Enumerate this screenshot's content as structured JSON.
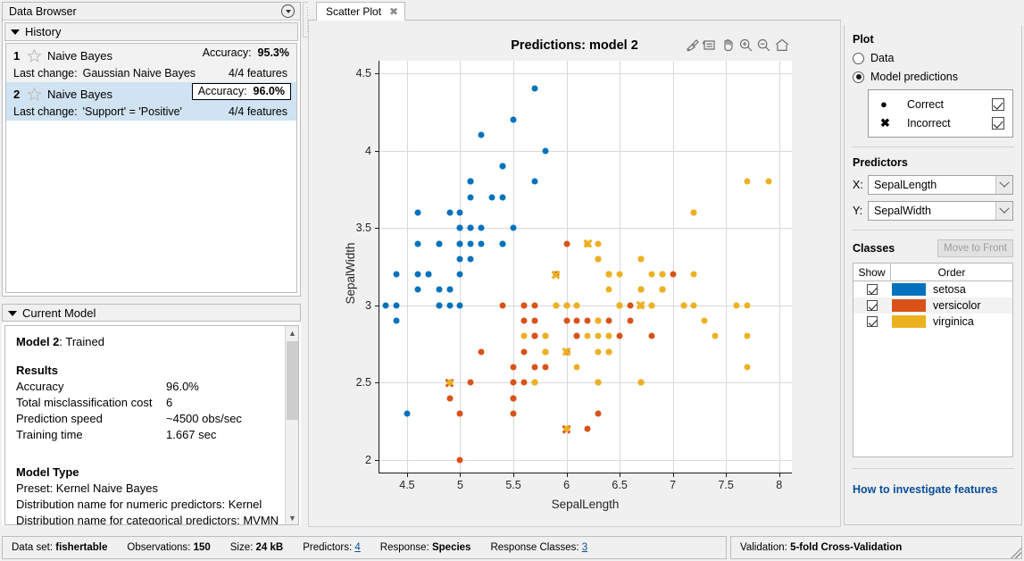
{
  "data_browser": {
    "title": "Data Browser",
    "collapse_icon": "chevron-down-circle-icon",
    "history": {
      "title": "History",
      "items": [
        {
          "index": "1",
          "name": "Naive Bayes",
          "accuracy_label": "Accuracy:",
          "accuracy_value": "95.3%",
          "last_change_label": "Last change:",
          "last_change_value": "Gaussian Naive Bayes",
          "features": "4/4 features",
          "selected": false
        },
        {
          "index": "2",
          "name": "Naive Bayes",
          "accuracy_label": "Accuracy:",
          "accuracy_value": "96.0%",
          "last_change_label": "Last change:",
          "last_change_value": "'Support' = 'Positive'",
          "features": "4/4 features",
          "selected": true
        }
      ]
    }
  },
  "current_model": {
    "title": "Current Model",
    "heading_bold": "Model 2",
    "heading_rest": ": Trained",
    "results_title": "Results",
    "results": [
      {
        "key": "Accuracy",
        "value": "96.0%"
      },
      {
        "key": "Total misclassification cost",
        "value": "6"
      },
      {
        "key": "Prediction speed",
        "value": "~4500 obs/sec"
      },
      {
        "key": "Training time",
        "value": "1.667 sec"
      }
    ],
    "model_type_title": "Model Type",
    "model_type_lines": [
      "Preset: Kernel Naive Bayes",
      "Distribution name for numeric predictors: Kernel",
      "Distribution name for categorical predictors: MVMN"
    ]
  },
  "tabs": [
    {
      "label": "Scatter Plot",
      "close_icon": "close-icon",
      "active": true
    }
  ],
  "plot_toolbar": [
    "brush-data-icon",
    "export-legend-icon",
    "pan-hand-icon",
    "zoom-in-icon",
    "zoom-out-icon",
    "restore-home-icon"
  ],
  "right_panel": {
    "plot_section_title": "Plot",
    "radios": [
      {
        "label": "Data",
        "selected": false
      },
      {
        "label": "Model predictions",
        "selected": true
      }
    ],
    "legend": [
      {
        "glyph": "filled-circle-marker",
        "label": "Correct",
        "checked": true
      },
      {
        "glyph": "cross-marker",
        "label": "Incorrect",
        "checked": true
      }
    ],
    "predictors_title": "Predictors",
    "predictor_x_label": "X:",
    "predictor_x_value": "SepalLength",
    "predictor_y_label": "Y:",
    "predictor_y_value": "SepalWidth",
    "classes_title": "Classes",
    "move_to_front_label": "Move to Front",
    "class_table": {
      "columns": [
        "Show",
        "Order"
      ],
      "rows": [
        {
          "show": true,
          "color": "#0072BD",
          "name": "setosa"
        },
        {
          "show": true,
          "color": "#D95319",
          "name": "versicolor"
        },
        {
          "show": true,
          "color": "#EDB120",
          "name": "virginica"
        }
      ]
    },
    "how_to_link": "How to investigate features"
  },
  "status_bar": {
    "left": [
      {
        "label": "Data set:",
        "value": "fishertable",
        "bold": true,
        "link": false
      },
      {
        "label": "Observations:",
        "value": "150",
        "bold": true,
        "link": false
      },
      {
        "label": "Size:",
        "value": "24 kB",
        "bold": true,
        "link": false
      },
      {
        "label": "Predictors:",
        "value": "4",
        "bold": false,
        "link": true
      },
      {
        "label": "Response:",
        "value": "Species",
        "bold": true,
        "link": false
      },
      {
        "label": "Response Classes:",
        "value": "3",
        "bold": false,
        "link": true
      }
    ],
    "right": [
      {
        "label": "Validation:",
        "value": "5-fold Cross-Validation",
        "bold": true,
        "link": false
      }
    ]
  },
  "chart_data": {
    "type": "scatter",
    "title": "Predictions: model 2",
    "xlabel": "SepalLength",
    "ylabel": "SepalWidth",
    "xlim": [
      4.24,
      8.12
    ],
    "ylim": [
      1.92,
      4.58
    ],
    "xticks": [
      4.5,
      5,
      5.5,
      6,
      6.5,
      7,
      7.5,
      8
    ],
    "yticks": [
      2,
      2.5,
      3,
      3.5,
      4,
      4.5
    ],
    "grid": true,
    "legend_position": "external-right-panel",
    "series": [
      {
        "name": "setosa",
        "color": "#0072BD",
        "correct": [
          [
            5.1,
            3.5
          ],
          [
            4.9,
            3.0
          ],
          [
            4.7,
            3.2
          ],
          [
            4.6,
            3.1
          ],
          [
            5.0,
            3.6
          ],
          [
            5.4,
            3.9
          ],
          [
            4.6,
            3.4
          ],
          [
            5.0,
            3.4
          ],
          [
            4.4,
            2.9
          ],
          [
            4.9,
            3.1
          ],
          [
            5.4,
            3.7
          ],
          [
            4.8,
            3.4
          ],
          [
            4.8,
            3.0
          ],
          [
            4.3,
            3.0
          ],
          [
            5.8,
            4.0
          ],
          [
            5.7,
            4.4
          ],
          [
            5.4,
            3.9
          ],
          [
            5.1,
            3.5
          ],
          [
            5.7,
            3.8
          ],
          [
            5.1,
            3.8
          ],
          [
            5.4,
            3.4
          ],
          [
            5.1,
            3.7
          ],
          [
            4.6,
            3.6
          ],
          [
            5.1,
            3.3
          ],
          [
            4.8,
            3.4
          ],
          [
            5.0,
            3.0
          ],
          [
            5.0,
            3.4
          ],
          [
            5.2,
            3.5
          ],
          [
            5.2,
            3.4
          ],
          [
            4.7,
            3.2
          ],
          [
            4.8,
            3.1
          ],
          [
            5.4,
            3.4
          ],
          [
            5.2,
            4.1
          ],
          [
            5.5,
            4.2
          ],
          [
            4.9,
            3.1
          ],
          [
            5.0,
            3.2
          ],
          [
            5.5,
            3.5
          ],
          [
            4.9,
            3.6
          ],
          [
            4.4,
            3.0
          ],
          [
            5.1,
            3.4
          ],
          [
            5.0,
            3.5
          ],
          [
            4.5,
            2.3
          ],
          [
            4.4,
            3.2
          ],
          [
            5.0,
            3.5
          ],
          [
            5.1,
            3.8
          ],
          [
            4.8,
            3.0
          ],
          [
            5.1,
            3.8
          ],
          [
            4.6,
            3.2
          ],
          [
            5.3,
            3.7
          ],
          [
            5.0,
            3.3
          ]
        ],
        "incorrect": []
      },
      {
        "name": "versicolor",
        "color": "#D95319",
        "correct": [
          [
            7.0,
            3.2
          ],
          [
            6.4,
            3.2
          ],
          [
            6.9,
            3.1
          ],
          [
            5.5,
            2.3
          ],
          [
            6.5,
            2.8
          ],
          [
            5.7,
            2.8
          ],
          [
            4.9,
            2.4
          ],
          [
            6.6,
            2.9
          ],
          [
            5.2,
            2.7
          ],
          [
            5.0,
            2.0
          ],
          [
            5.9,
            3.0
          ],
          [
            6.0,
            2.2
          ],
          [
            6.1,
            2.9
          ],
          [
            5.6,
            2.9
          ],
          [
            6.7,
            3.1
          ],
          [
            5.6,
            3.0
          ],
          [
            5.8,
            2.7
          ],
          [
            6.2,
            2.2
          ],
          [
            5.6,
            2.5
          ],
          [
            5.9,
            3.2
          ],
          [
            6.1,
            2.8
          ],
          [
            6.3,
            2.5
          ],
          [
            6.1,
            2.8
          ],
          [
            6.4,
            2.9
          ],
          [
            6.6,
            3.0
          ],
          [
            6.8,
            2.8
          ],
          [
            6.7,
            3.0
          ],
          [
            6.0,
            2.9
          ],
          [
            5.7,
            2.6
          ],
          [
            5.5,
            2.4
          ],
          [
            5.5,
            2.4
          ],
          [
            5.8,
            2.7
          ],
          [
            6.0,
            2.7
          ],
          [
            5.4,
            3.0
          ],
          [
            6.0,
            3.4
          ],
          [
            6.7,
            3.1
          ],
          [
            6.3,
            2.3
          ],
          [
            5.6,
            3.0
          ],
          [
            5.5,
            2.5
          ],
          [
            5.5,
            2.6
          ],
          [
            6.1,
            3.0
          ],
          [
            5.8,
            2.6
          ],
          [
            5.0,
            2.3
          ],
          [
            5.6,
            2.7
          ],
          [
            5.7,
            3.0
          ],
          [
            5.7,
            2.9
          ],
          [
            6.2,
            2.9
          ],
          [
            5.1,
            2.5
          ],
          [
            5.7,
            2.8
          ],
          [
            6.3,
            3.3
          ],
          [
            5.8,
            2.8
          ],
          [
            7.1,
            3.0
          ],
          [
            6.3,
            2.9
          ],
          [
            6.5,
            3.0
          ],
          [
            6.9,
            3.1
          ],
          [
            6.7,
            2.5
          ],
          [
            7.2,
            3.6
          ],
          [
            6.4,
            2.7
          ],
          [
            6.8,
            3.0
          ],
          [
            5.7,
            2.5
          ],
          [
            6.4,
            3.2
          ],
          [
            6.5,
            3.0
          ],
          [
            6.0,
            3.0
          ],
          [
            6.9,
            3.2
          ],
          [
            6.7,
            3.3
          ],
          [
            6.7,
            3.0
          ],
          [
            6.3,
            2.5
          ],
          [
            6.5,
            3.0
          ],
          [
            6.2,
            3.4
          ]
        ],
        "incorrect": [
          [
            4.9,
            2.5
          ],
          [
            6.0,
            2.2
          ]
        ]
      },
      {
        "name": "virginica",
        "color": "#EDB120",
        "correct": [
          [
            6.3,
            3.3
          ],
          [
            5.8,
            2.7
          ],
          [
            7.1,
            3.0
          ],
          [
            6.3,
            2.9
          ],
          [
            6.5,
            3.0
          ],
          [
            7.6,
            3.0
          ],
          [
            4.9,
            2.5
          ],
          [
            7.3,
            2.9
          ],
          [
            6.7,
            2.5
          ],
          [
            7.2,
            3.6
          ],
          [
            6.5,
            3.2
          ],
          [
            6.4,
            2.7
          ],
          [
            6.8,
            3.0
          ],
          [
            5.7,
            2.5
          ],
          [
            5.8,
            2.8
          ],
          [
            6.4,
            3.2
          ],
          [
            6.5,
            3.0
          ],
          [
            7.7,
            3.8
          ],
          [
            7.7,
            2.6
          ],
          [
            6.0,
            2.2
          ],
          [
            6.9,
            3.2
          ],
          [
            5.6,
            2.8
          ],
          [
            7.7,
            2.8
          ],
          [
            6.3,
            2.7
          ],
          [
            6.7,
            3.3
          ],
          [
            7.2,
            3.2
          ],
          [
            6.2,
            2.8
          ],
          [
            6.1,
            3.0
          ],
          [
            6.4,
            2.8
          ],
          [
            7.2,
            3.0
          ],
          [
            7.4,
            2.8
          ],
          [
            7.9,
            3.8
          ],
          [
            6.4,
            2.8
          ],
          [
            6.3,
            2.8
          ],
          [
            6.1,
            2.6
          ],
          [
            7.7,
            3.0
          ],
          [
            6.3,
            3.4
          ],
          [
            6.4,
            3.1
          ],
          [
            6.0,
            3.0
          ],
          [
            6.9,
            3.1
          ],
          [
            6.7,
            3.1
          ],
          [
            6.9,
            3.1
          ],
          [
            5.8,
            2.7
          ],
          [
            6.8,
            3.2
          ],
          [
            6.7,
            3.3
          ],
          [
            6.7,
            3.0
          ],
          [
            6.3,
            2.5
          ],
          [
            6.5,
            3.0
          ],
          [
            6.2,
            3.4
          ],
          [
            5.9,
            3.0
          ]
        ],
        "incorrect": [
          [
            5.9,
            3.2
          ],
          [
            6.2,
            3.4
          ],
          [
            6.0,
            2.7
          ],
          [
            6.7,
            3.0
          ]
        ]
      }
    ]
  }
}
